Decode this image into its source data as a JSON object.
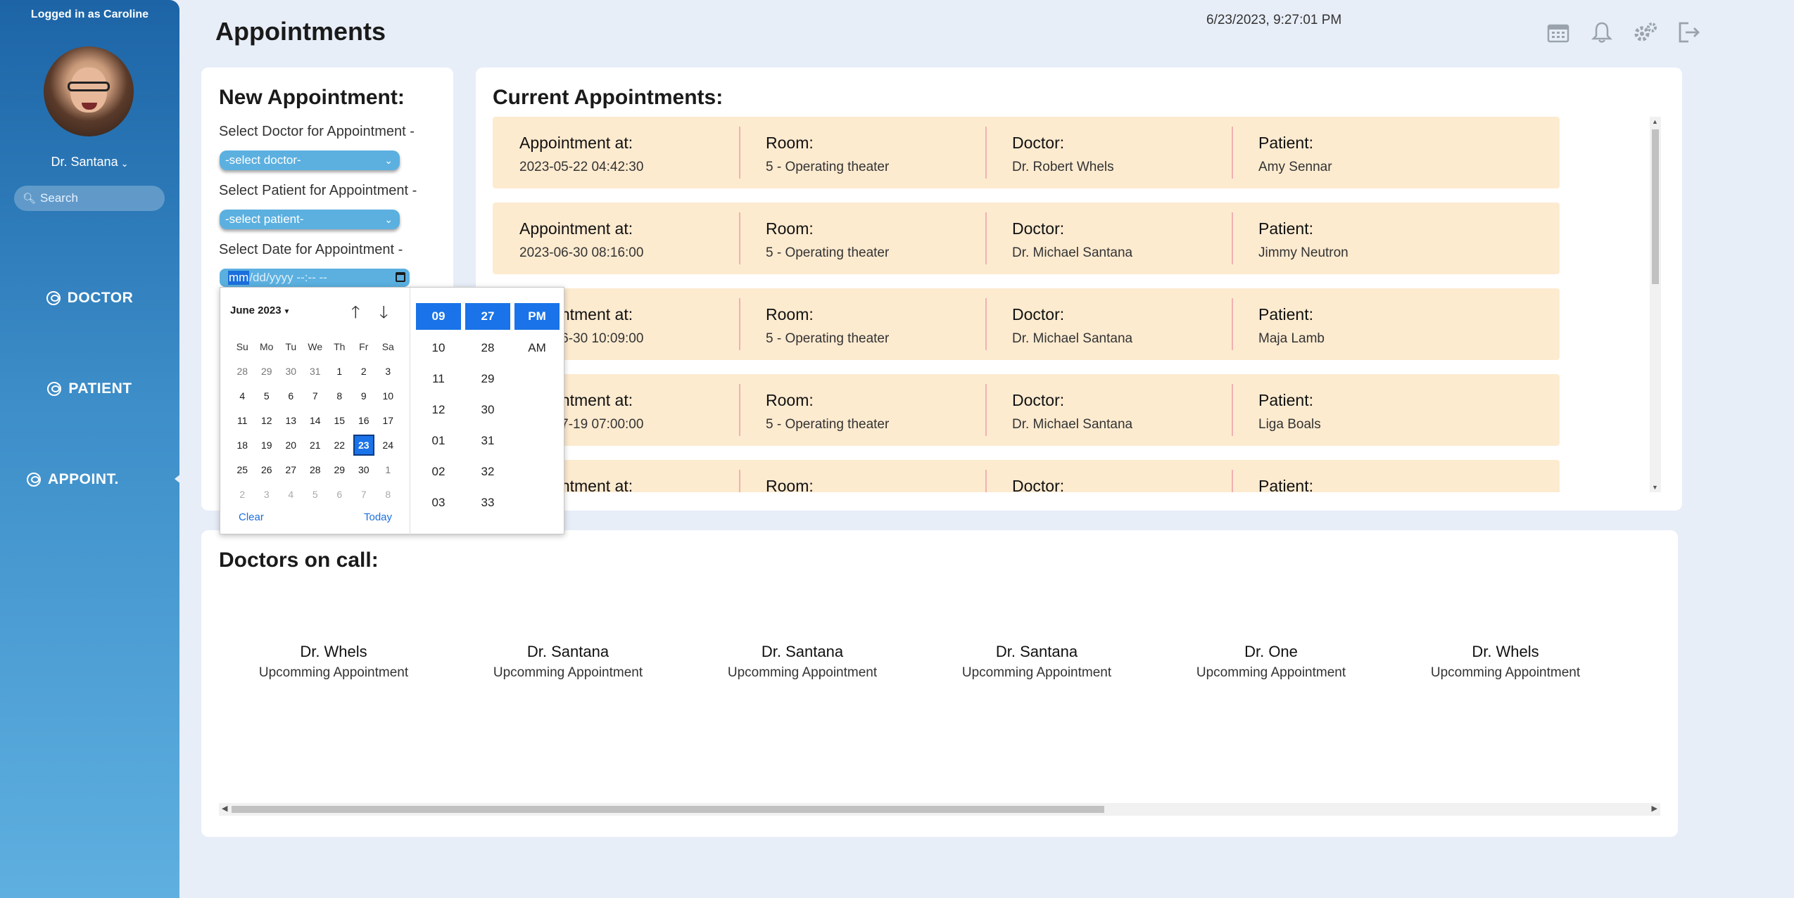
{
  "sidebar": {
    "logged_in": "Logged in as Caroline",
    "user_name": "Dr. Santana",
    "search_placeholder": "Search",
    "nav": [
      "DOCTOR",
      "PATIENT",
      "APPOINT."
    ]
  },
  "header": {
    "title": "Appointments",
    "datetime": "6/23/2023, 9:27:01 PM",
    "icons": [
      "calendar-icon",
      "bell-icon",
      "gears-icon",
      "logout-icon"
    ]
  },
  "new_appointment": {
    "title": "New Appointment:",
    "doctor_label": "Select Doctor for Appointment -",
    "doctor_value": "-select doctor-",
    "patient_label": "Select Patient for Appointment -",
    "patient_value": "-select patient-",
    "date_label": "Select Date for Appointment -",
    "date_mm": "mm",
    "date_rest": "/dd/yyyy --:-- --"
  },
  "picker": {
    "month": "June 2023",
    "weekdays": [
      "Su",
      "Mo",
      "Tu",
      "We",
      "Th",
      "Fr",
      "Sa"
    ],
    "weeks": [
      [
        "28",
        "29",
        "30",
        "31",
        "1",
        "2",
        "3"
      ],
      [
        "4",
        "5",
        "6",
        "7",
        "8",
        "9",
        "10"
      ],
      [
        "11",
        "12",
        "13",
        "14",
        "15",
        "16",
        "17"
      ],
      [
        "18",
        "19",
        "20",
        "21",
        "22",
        "23",
        "24"
      ],
      [
        "25",
        "26",
        "27",
        "28",
        "29",
        "30",
        "1"
      ],
      [
        "2",
        "3",
        "4",
        "5",
        "6",
        "7",
        "8"
      ]
    ],
    "selected_day": "23",
    "clear": "Clear",
    "today": "Today",
    "hours": [
      "09",
      "10",
      "11",
      "12",
      "01",
      "02",
      "03"
    ],
    "minutes": [
      "27",
      "28",
      "29",
      "30",
      "31",
      "32",
      "33"
    ],
    "ampm": [
      "PM",
      "AM"
    ]
  },
  "current": {
    "title": "Current Appointments:",
    "labels": {
      "at": "Appointment at:",
      "room": "Room:",
      "doctor": "Doctor:",
      "patient": "Patient:"
    },
    "rows": [
      {
        "at": "2023-05-22 04:42:30",
        "room": "5 - Operating theater",
        "doctor": "Dr. Robert Whels",
        "patient": "Amy Sennar"
      },
      {
        "at": "2023-06-30 08:16:00",
        "room": "5 - Operating theater",
        "doctor": "Dr. Michael Santana",
        "patient": "Jimmy Neutron"
      },
      {
        "at": "2023-06-30 10:09:00",
        "room": "5 - Operating theater",
        "doctor": "Dr. Michael Santana",
        "patient": "Maja Lamb"
      },
      {
        "at": "2023-07-19 07:00:00",
        "room": "5 - Operating theater",
        "doctor": "Dr. Michael Santana",
        "patient": "Liga Boals"
      },
      {
        "at": "",
        "room": "",
        "doctor": "",
        "patient": ""
      }
    ]
  },
  "on_call": {
    "title": "Doctors on call:",
    "doctors": [
      {
        "name": "Dr. Whels",
        "status": "Upcomming Appointment"
      },
      {
        "name": "Dr. Santana",
        "status": "Upcomming Appointment"
      },
      {
        "name": "Dr. Santana",
        "status": "Upcomming Appointment"
      },
      {
        "name": "Dr. Santana",
        "status": "Upcomming Appointment"
      },
      {
        "name": "Dr. One",
        "status": "Upcomming Appointment"
      },
      {
        "name": "Dr. Whels",
        "status": "Upcomming Appointment"
      },
      {
        "name": "",
        "status": "Upcomming Appointment"
      }
    ]
  }
}
